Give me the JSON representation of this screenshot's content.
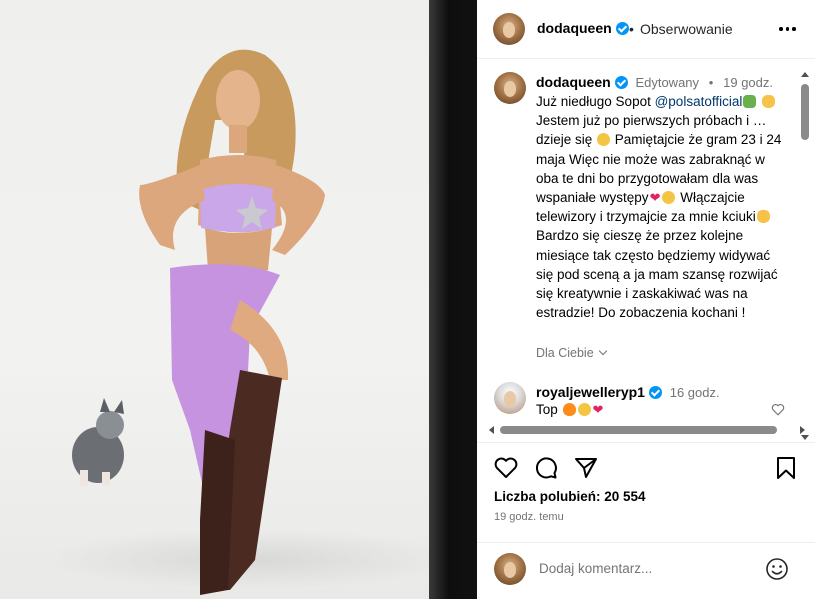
{
  "post": {
    "username": "dodaqueen",
    "follow_status": "Obserwowanie",
    "separator": "•"
  },
  "caption": {
    "username": "dodaqueen",
    "edited_label": "Edytowany",
    "separator": "•",
    "time": "19 godz.",
    "part1": "Już niedługo Sopot ",
    "mention": "@polsatofficial",
    "part2": " Jestem już po pierwszych próbach i …dzieje się ",
    "part3": " Pamiętajcie że gram 23 i 24 maja Więc nie może was zabraknąć w oba te dni bo przygotowałam dla was wspaniałe występy",
    "part4": " Włączajcie telewizory i trzymajcie za mnie kciuki",
    "part5": " Bardzo się cieszę że przez kolejne miesiące tak często będziemy widywać się pod sceną a ja mam szansę rozwijać się kreatywnie i zaskakiwać was na estradzie! Do zobaczenia kochani !"
  },
  "for_you_label": "Dla Ciebie",
  "comment": {
    "username": "royaljewelleryp1",
    "time": "16 godz.",
    "text": "Top"
  },
  "likes_text": "Liczba polubień: 20 554",
  "posted_ago": "19 godz. temu",
  "add_comment": {
    "placeholder": "Dodaj komentarz..."
  },
  "icons": {
    "like": "heart-outline-icon",
    "comment": "comment-bubble-icon",
    "share": "paper-plane-icon",
    "save": "bookmark-icon",
    "emoji": "smiley-icon",
    "more": "three-dots-icon"
  },
  "colors": {
    "verified": "#0095f6",
    "mention": "#00376b",
    "secondary_text": "#737373",
    "heart": "#e0245e"
  }
}
